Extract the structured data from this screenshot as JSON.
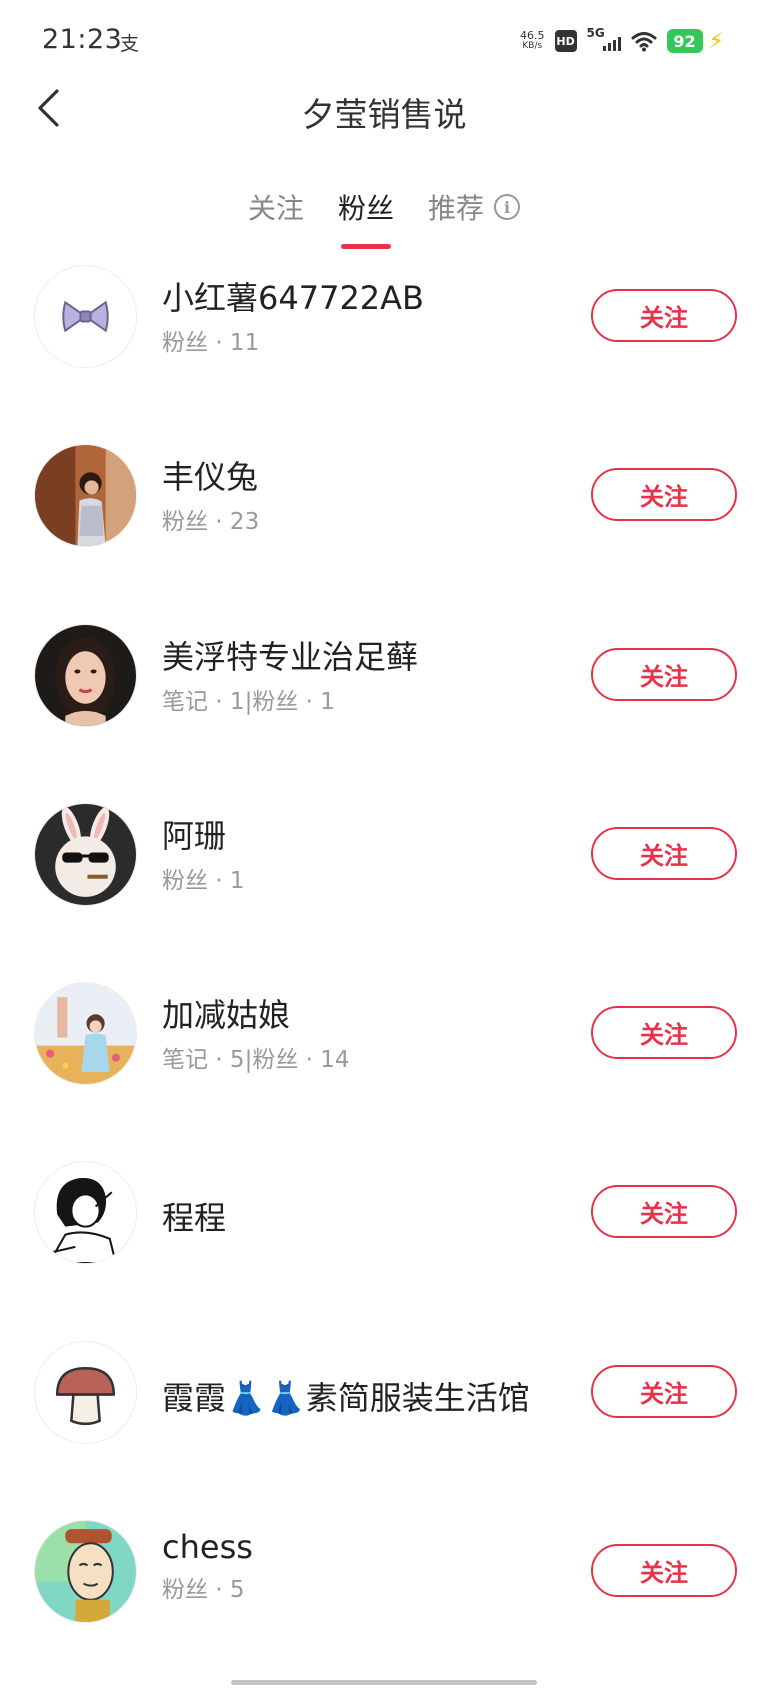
{
  "status_bar": {
    "time": "21:23",
    "app_icon_glyph": "支",
    "net_speed_value": "46.5",
    "net_speed_unit": "KB/s",
    "hd_label": "HD",
    "signal_label": "5G",
    "battery": "92"
  },
  "nav": {
    "title": "夕莹销售说"
  },
  "tabs": [
    {
      "label": "关注",
      "active": false
    },
    {
      "label": "粉丝",
      "active": true
    },
    {
      "label": "推荐",
      "active": false
    }
  ],
  "accent_color": "#e8324a",
  "fans": [
    {
      "name": "小红薯647722AB",
      "meta": "粉丝 · 11",
      "button": "关注",
      "avatar": "bow-icon"
    },
    {
      "name": "丰仪兔",
      "meta": "粉丝 · 23",
      "button": "关注",
      "avatar": "photo-woman-door"
    },
    {
      "name": "美浮特专业治足藓",
      "meta": "笔记 · 1|粉丝 · 1",
      "button": "关注",
      "avatar": "photo-woman-portrait"
    },
    {
      "name": "阿珊",
      "meta": "粉丝 · 1",
      "button": "关注",
      "avatar": "rabbit-sunglasses"
    },
    {
      "name": "加减姑娘",
      "meta": "笔记 · 5|粉丝 · 14",
      "button": "关注",
      "avatar": "photo-woman-flowers"
    },
    {
      "name": "程程",
      "meta": "",
      "button": "关注",
      "avatar": "sketch-girl"
    },
    {
      "name": "霞霞👗👗素简服装生活馆",
      "meta": "",
      "button": "关注",
      "avatar": "mushroom-icon"
    },
    {
      "name": "chess",
      "meta": "粉丝 · 5",
      "button": "关注",
      "avatar": "cartoon-boy"
    }
  ]
}
